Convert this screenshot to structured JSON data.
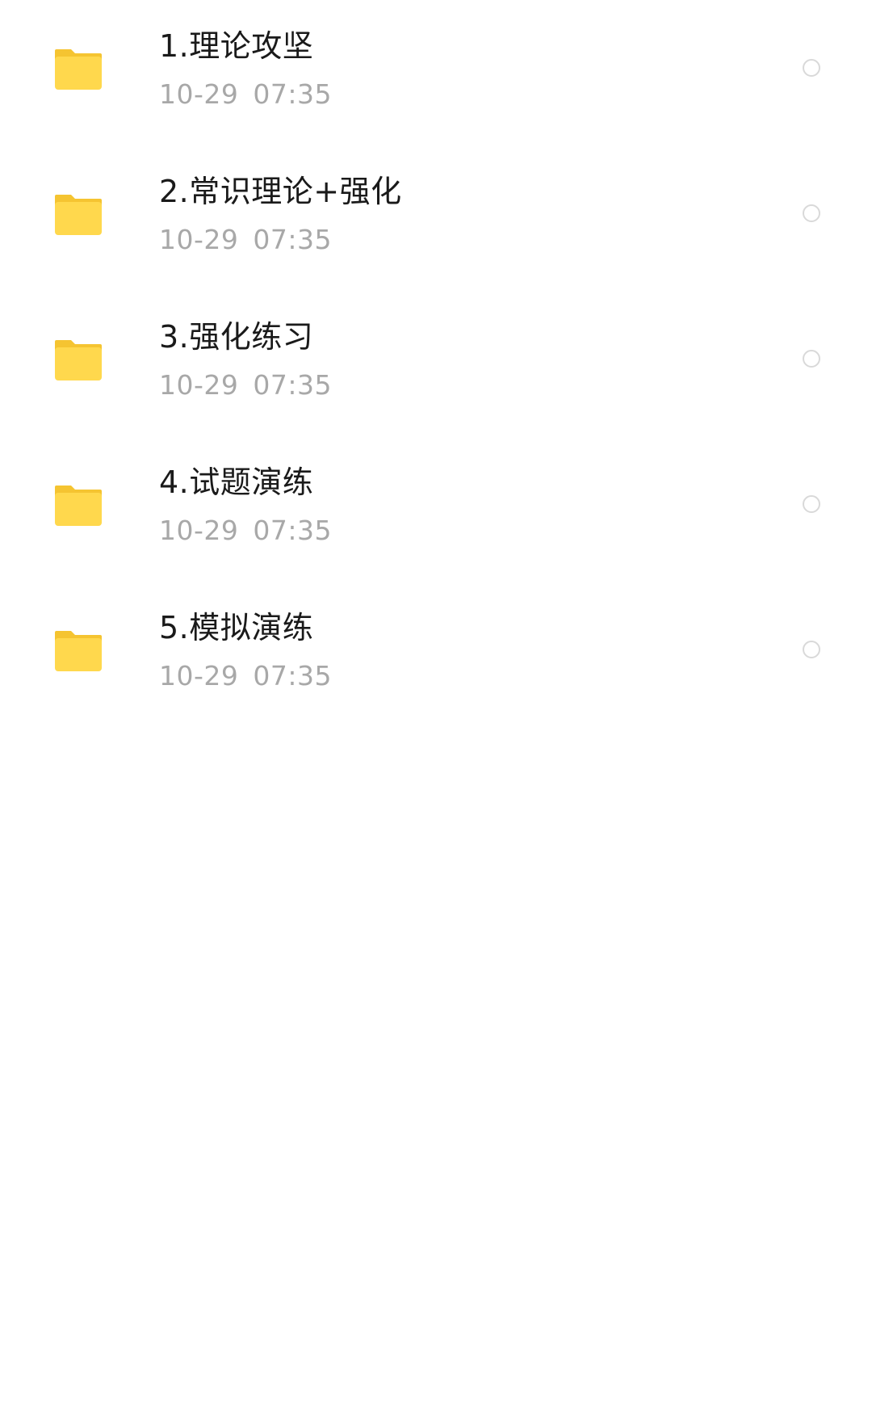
{
  "files": [
    {
      "name": "1.理论攻坚",
      "date": "10-29",
      "time": "07:35",
      "icon": "folder-icon"
    },
    {
      "name": "2.常识理论+强化",
      "date": "10-29",
      "time": "07:35",
      "icon": "folder-icon"
    },
    {
      "name": "3.强化练习",
      "date": "10-29",
      "time": "07:35",
      "icon": "folder-icon"
    },
    {
      "name": "4.试题演练",
      "date": "10-29",
      "time": "07:35",
      "icon": "folder-icon"
    },
    {
      "name": "5.模拟演练",
      "date": "10-29",
      "time": "07:35",
      "icon": "folder-icon"
    }
  ],
  "colors": {
    "folder_front": "#FFD84D",
    "folder_back": "#F5C431",
    "meta_text": "#A8A8A8",
    "circle_border": "#D9D9D9"
  }
}
